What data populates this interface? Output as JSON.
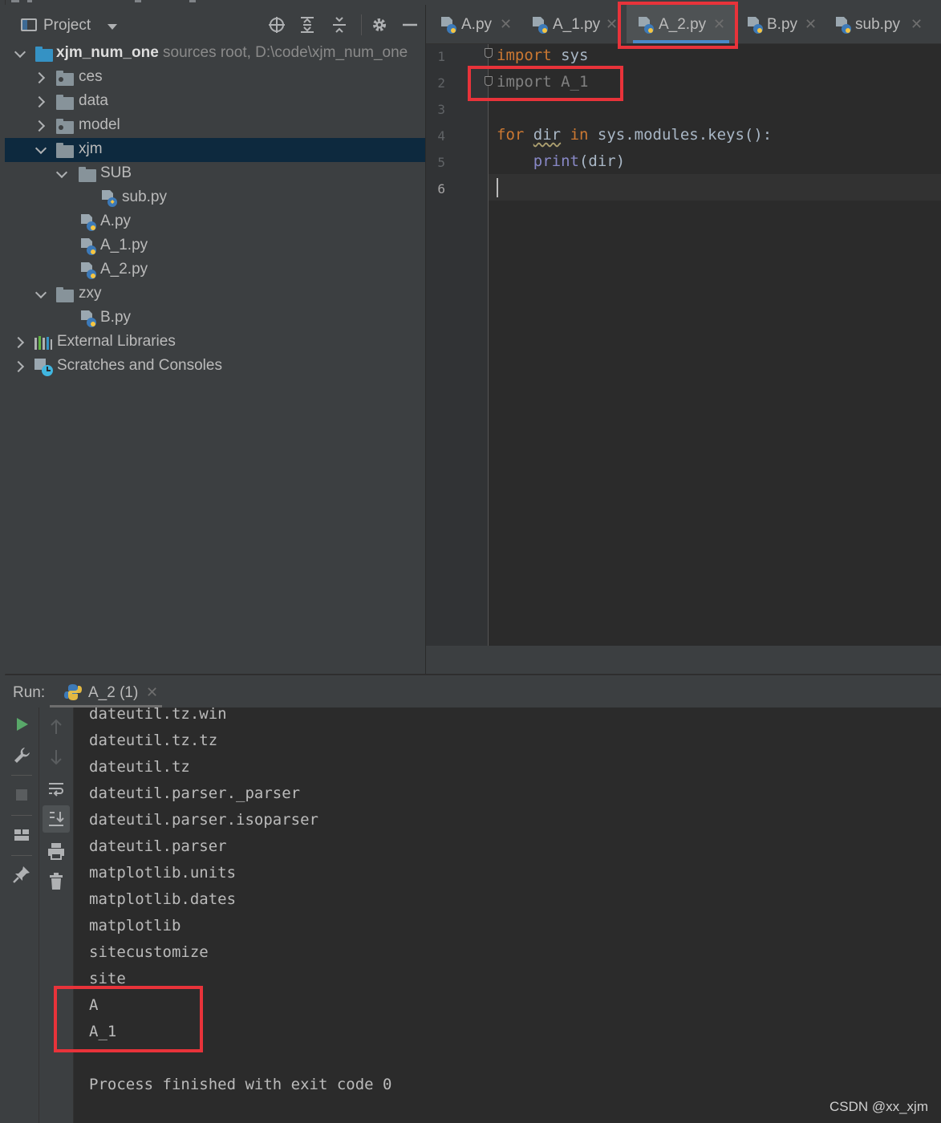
{
  "project": {
    "title": "Project",
    "tree": [
      {
        "label": "xjm_num_one",
        "extra": "sources root,  D:\\code\\xjm_num_one"
      },
      {
        "label": "ces"
      },
      {
        "label": "data"
      },
      {
        "label": "model"
      },
      {
        "label": "xjm"
      },
      {
        "label": "SUB"
      },
      {
        "label": "sub.py"
      },
      {
        "label": "A.py"
      },
      {
        "label": "A_1.py"
      },
      {
        "label": "A_2.py"
      },
      {
        "label": "zxy"
      },
      {
        "label": "B.py"
      },
      {
        "label": "External Libraries"
      },
      {
        "label": "Scratches and Consoles"
      }
    ]
  },
  "tabs": [
    {
      "label": "A.py"
    },
    {
      "label": "A_1.py"
    },
    {
      "label": "A_2.py"
    },
    {
      "label": "B.py"
    },
    {
      "label": "sub.py"
    }
  ],
  "editor": {
    "line_numbers": [
      "1",
      "2",
      "3",
      "4",
      "5",
      "6"
    ],
    "code": {
      "l1_kw": "import",
      "l1_rest": " sys",
      "l2_kw": "import",
      "l2_rest": " A_1",
      "l4_for": "for",
      "l4_var": "dir",
      "l4_in": "in",
      "l4_rest": " sys.modules.keys():",
      "l5_fn": "print",
      "l5_rest": "(dir)"
    }
  },
  "run": {
    "label": "Run:",
    "tab_label": "A_2 (1)",
    "output": [
      "dateutil.tz.win",
      "dateutil.tz.tz",
      "dateutil.tz",
      "dateutil.parser._parser",
      "dateutil.parser.isoparser",
      "dateutil.parser",
      "matplotlib.units",
      "matplotlib.dates",
      "matplotlib",
      "sitecustomize",
      "site",
      "A",
      "A_1",
      "",
      "Process finished with exit code 0"
    ]
  },
  "watermark": "CSDN @xx_xjm",
  "colors": {
    "highlight": "#e8333a",
    "accent": "#4a88c7",
    "selection": "#0d293e"
  }
}
